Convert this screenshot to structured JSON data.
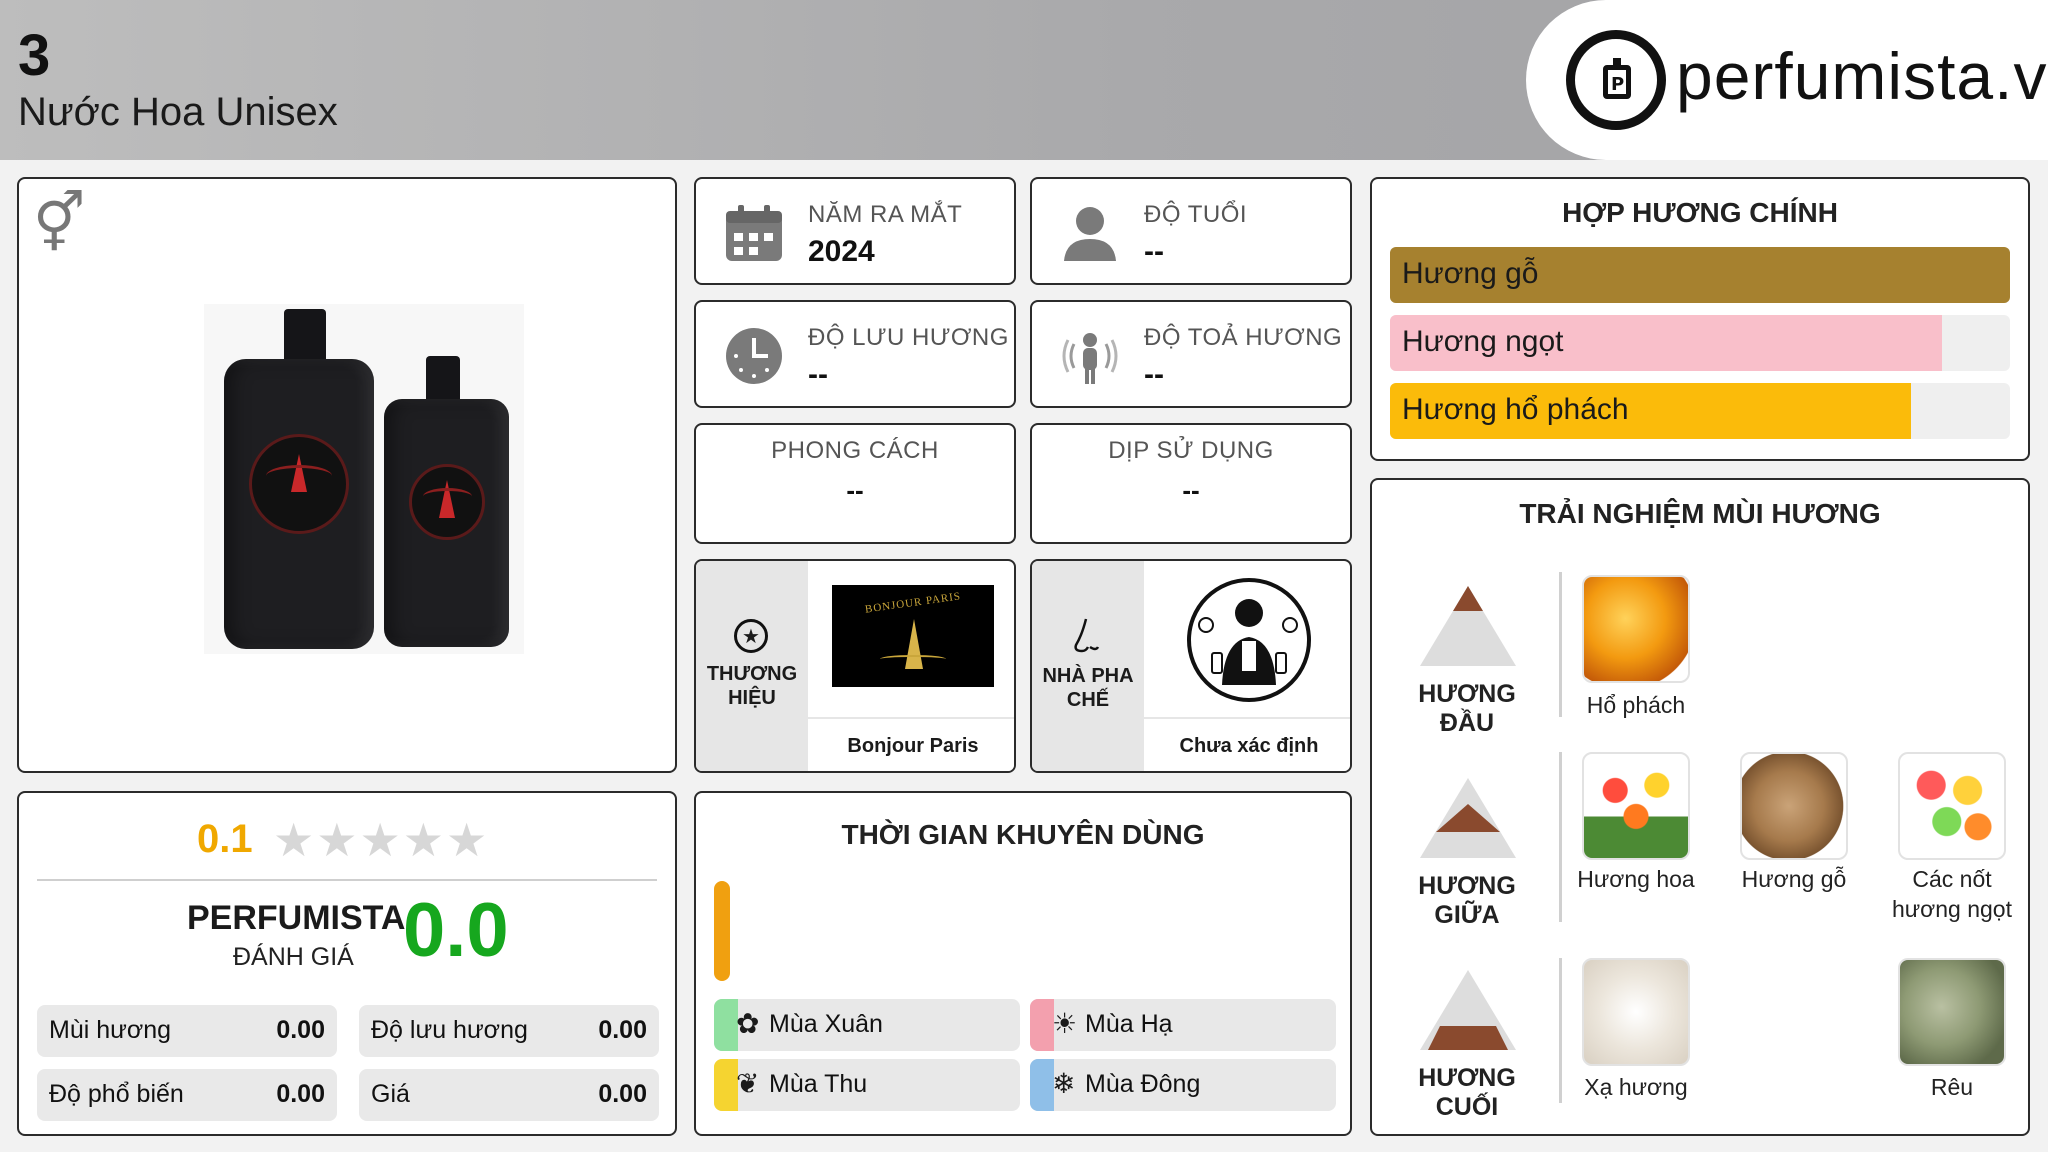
{
  "header": {
    "rank": "3",
    "subtitle": "Nước Hoa Unisex",
    "logo_text": "perfumista.vn"
  },
  "product": {
    "gender_icon": "unisex-gender-icon"
  },
  "info": {
    "release_year": {
      "label": "NĂM RA MẮT",
      "value": "2024"
    },
    "age": {
      "label": "ĐỘ TUỔI",
      "value": "--"
    },
    "longevity": {
      "label": "ĐỘ LƯU HƯƠNG",
      "value": "--"
    },
    "sillage": {
      "label": "ĐỘ TOẢ HƯƠNG",
      "value": "--"
    },
    "style": {
      "label": "PHONG CÁCH",
      "value": "--"
    },
    "occasion": {
      "label": "DỊP SỬ DỤNG",
      "value": "--"
    },
    "brand": {
      "label_1": "THƯƠNG",
      "label_2": "HIỆU",
      "name": "Bonjour Paris",
      "logo_text": "BONJOUR PARIS"
    },
    "perfumer": {
      "label_1": "NHÀ PHA",
      "label_2": "CHẾ",
      "name": "Chưa xác định"
    }
  },
  "accords": {
    "title": "HỢP HƯƠNG CHÍNH",
    "items": [
      {
        "label": "Hương gỗ",
        "fraction": 1.0,
        "color": "#a6812f"
      },
      {
        "label": "Hương ngọt",
        "fraction": 0.89,
        "color": "#f9bfca"
      },
      {
        "label": "Hương hổ phách",
        "fraction": 0.84,
        "color": "#fbbb0a"
      }
    ]
  },
  "rating": {
    "score": "0.1",
    "stars": "★★★★★",
    "perfumista_label": "PERFUMISTA",
    "review_label": "ĐÁNH GIÁ",
    "perfumista_score": "0.0",
    "metrics": [
      {
        "label": "Mùi hương",
        "value": "0.00"
      },
      {
        "label": "Độ lưu hương",
        "value": "0.00"
      },
      {
        "label": "Độ phổ biến",
        "value": "0.00"
      },
      {
        "label": "Giá",
        "value": "0.00"
      }
    ]
  },
  "usage": {
    "title": "THỜI GIAN KHUYÊN DÙNG",
    "seasons": [
      {
        "label": "Mùa Xuân",
        "icon": "flower-icon",
        "color": "#8fe0a0"
      },
      {
        "label": "Mùa Hạ",
        "icon": "sun-icon",
        "color": "#f3a0ae"
      },
      {
        "label": "Mùa Thu",
        "icon": "leaf-icon",
        "color": "#f5d430"
      },
      {
        "label": "Mùa Đông",
        "icon": "snowflake-icon",
        "color": "#8fbfe8"
      }
    ],
    "day_bar_color": "#f0a010"
  },
  "notes": {
    "title": "TRẢI NGHIỆM MÙI HƯƠNG",
    "top": {
      "label": "HƯƠNG ĐẦU",
      "items": [
        "Hổ phách"
      ]
    },
    "middle": {
      "label": "HƯƠNG GIỮA",
      "items": [
        "Hương hoa",
        "Hương gỗ",
        "Các nốt",
        "hương ngọt"
      ]
    },
    "base": {
      "label": "HƯƠNG CUỐI",
      "items": [
        "Xạ hương",
        "Rêu"
      ]
    }
  }
}
